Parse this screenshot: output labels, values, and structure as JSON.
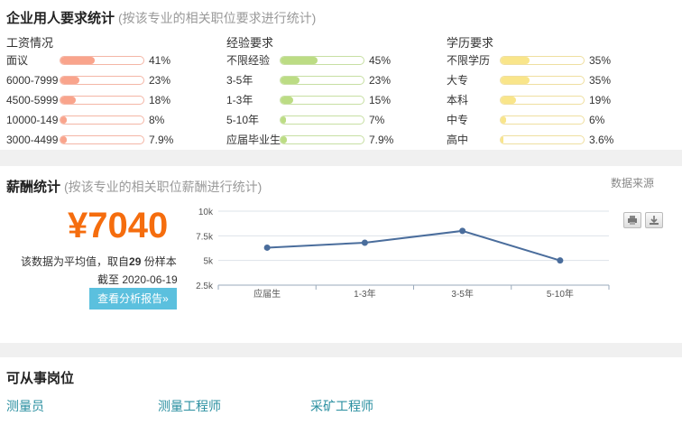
{
  "requirements": {
    "title": "企业用人要求统计",
    "note": "(按该专业的相关职位要求进行统计)",
    "groups": [
      {
        "title": "工资情况",
        "color": "#f9a48c",
        "border": "#f4b6a6",
        "rows": [
          {
            "label": "面议",
            "value": 41,
            "pct": "41%"
          },
          {
            "label": "6000-7999",
            "value": 23,
            "pct": "23%"
          },
          {
            "label": "4500-5999",
            "value": 18,
            "pct": "18%"
          },
          {
            "label": "10000-149",
            "value": 8,
            "pct": "8%"
          },
          {
            "label": "3000-4499",
            "value": 7.9,
            "pct": "7.9%"
          }
        ]
      },
      {
        "title": "经验要求",
        "color": "#bcdc84",
        "border": "#c7dfa3",
        "rows": [
          {
            "label": "不限经验",
            "value": 45,
            "pct": "45%"
          },
          {
            "label": "3-5年",
            "value": 23,
            "pct": "23%"
          },
          {
            "label": "1-3年",
            "value": 15,
            "pct": "15%"
          },
          {
            "label": "5-10年",
            "value": 7,
            "pct": "7%"
          },
          {
            "label": "应届毕业生",
            "value": 7.9,
            "pct": "7.9%"
          }
        ]
      },
      {
        "title": "学历要求",
        "color": "#f9e58a",
        "border": "#efdfa0",
        "rows": [
          {
            "label": "不限学历",
            "value": 35,
            "pct": "35%"
          },
          {
            "label": "大专",
            "value": 35,
            "pct": "35%"
          },
          {
            "label": "本科",
            "value": 19,
            "pct": "19%"
          },
          {
            "label": "中专",
            "value": 6,
            "pct": "6%"
          },
          {
            "label": "高中",
            "value": 3.6,
            "pct": "3.6%"
          }
        ]
      }
    ]
  },
  "salary": {
    "title": "薪酬统计",
    "note": "(按该专业的相关职位薪酬进行统计)",
    "amount": "¥7040",
    "avg_prefix": "该数据为平均值，取自",
    "sample_count": "29",
    "avg_suffix": " 份样本",
    "date": "截至 2020-06-19",
    "report_button": "查看分析报告»",
    "source_link": "数据来源",
    "accent_color": "#f56d0e"
  },
  "chart_data": {
    "type": "line",
    "categories": [
      "应届生",
      "1-3年",
      "3-5年",
      "5-10年"
    ],
    "values": [
      6300,
      6800,
      8000,
      5000
    ],
    "y_ticks": [
      2500,
      5000,
      7500,
      10000
    ],
    "y_tick_labels": [
      "2.5k",
      "5k",
      "7.5k",
      "10k"
    ],
    "ylim": [
      2500,
      10000
    ],
    "line_color": "#4a6d9c",
    "grid": true
  },
  "jobs": {
    "title": "可从事岗位",
    "items": [
      "测量员",
      "测量工程师",
      "采矿工程师"
    ]
  }
}
